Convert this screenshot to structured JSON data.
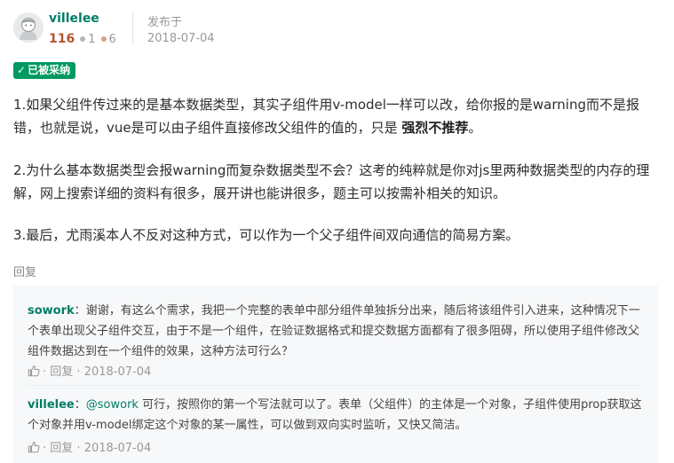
{
  "answer": {
    "author": "villelee",
    "reputation": "116",
    "silver_badges": "1",
    "bronze_badges": "6",
    "published_label": "发布于",
    "published_date": "2018-07-04",
    "accepted_label": "已被采纳",
    "p1_text": "1.如果父组件传过来的是基本数据类型，其实子组件用v-model一样可以改，给你报的是warning而不是报错，也就是说，vue是可以由子组件直接修改父组件的值的，只是 ",
    "p1_strong": "强烈不推荐",
    "p1_end": "。",
    "p2": "2.为什么基本数据类型会报warning而复杂数据类型不会？这考的纯粹就是你对js里两种数据类型的内存的理解，网上搜索详细的资料有很多，展开讲也能讲很多，题主可以按需补相关的知识。",
    "p3": "3.最后，尤雨溪本人不反对这种方式，可以作为一个父子组件间双向通信的简易方案。",
    "reply_label": "回复"
  },
  "comments": [
    {
      "author": "sowork",
      "colon": "：",
      "text": "谢谢，有这么个需求，我把一个完整的表单中部分组件单独拆分出来，随后将该组件引入进来，这种情况下一个表单出现父子组件交互，由于不是一个组件，在验证数据格式和提交数据方面都有了很多阻碍，所以使用子组件修改父组件数据达到在一个组件的效果，这种方法可行么？",
      "reply_label": "回复",
      "date": "2018-07-04"
    },
    {
      "author": "villelee",
      "colon": "：",
      "mention": "@sowork",
      "text": " 可行，按照你的第一个写法就可以了。表单（父组件）的主体是一个对象，子组件使用prop获取这个对象并用v-model绑定这个对象的某一属性，可以做到双向实时监听，又快又简洁。",
      "reply_label": "回复",
      "date": "2018-07-04"
    }
  ],
  "colors": {
    "accent": "#017e66",
    "accepted": "#009a61",
    "reputation": "#b3532b",
    "silver": "#b4b8bc",
    "bronze": "#d1a684"
  },
  "icons": [
    "avatar-illustration",
    "check-icon",
    "thumbs-up-icon"
  ]
}
